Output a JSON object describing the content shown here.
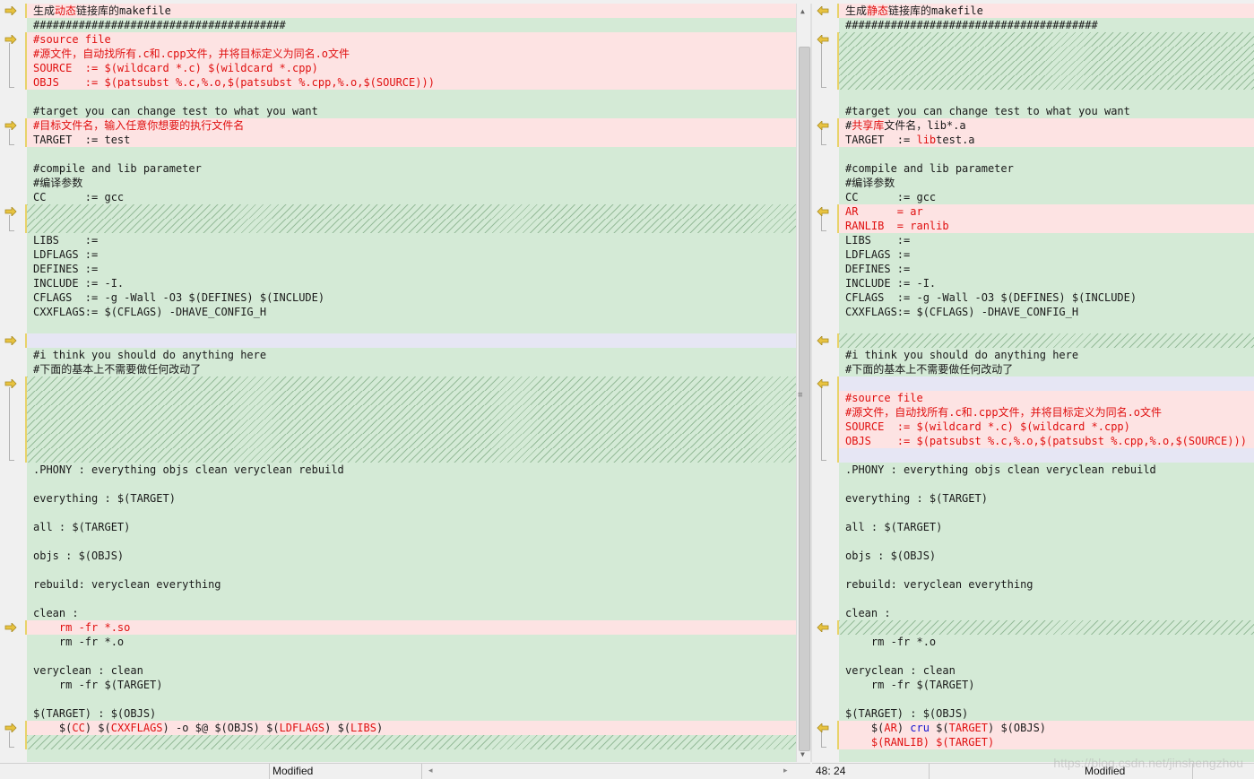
{
  "colors": {
    "equal_bg": "#d4ead6",
    "diff_bg": "#fde3e3",
    "diff_text": "#e01010",
    "arrow": "#e8c340"
  },
  "left": {
    "lines": [
      {
        "t": "diff",
        "p": [
          "生成",
          "动态",
          "链接库的makefile"
        ],
        "r": [
          false,
          true,
          false
        ]
      },
      {
        "t": "eq",
        "p": [
          "#######################################"
        ]
      },
      {
        "t": "diff",
        "p": [
          "#source file"
        ],
        "r": [
          true
        ]
      },
      {
        "t": "diff",
        "p": [
          "#源文件，自动找所有.c和.cpp文件，并将目标定义为同名.o文件"
        ],
        "r": [
          true
        ]
      },
      {
        "t": "diff",
        "p": [
          "SOURCE  := $(wildcard *.c) $(wildcard *.cpp)"
        ],
        "r": [
          true
        ]
      },
      {
        "t": "diff",
        "p": [
          "OBJS    := $(patsubst %.c,%.o,$(patsubst %.cpp,%.o,$(SOURCE)))"
        ],
        "r": [
          true
        ]
      },
      {
        "t": "eq",
        "p": [
          ""
        ]
      },
      {
        "t": "eq",
        "p": [
          "#target you can change test to what you want"
        ]
      },
      {
        "t": "diff",
        "p": [
          "#目标文件名，输入任意你想要的执行文件名"
        ],
        "r": [
          true
        ]
      },
      {
        "t": "diff",
        "p": [
          "TARGET  := test"
        ]
      },
      {
        "t": "eq",
        "p": [
          ""
        ]
      },
      {
        "t": "eq",
        "p": [
          "#compile and lib parameter"
        ]
      },
      {
        "t": "eq",
        "p": [
          "#编译参数"
        ]
      },
      {
        "t": "eq",
        "p": [
          "CC      := gcc"
        ]
      },
      {
        "t": "hatch",
        "p": [
          ""
        ]
      },
      {
        "t": "hatch",
        "p": [
          ""
        ]
      },
      {
        "t": "eq",
        "p": [
          "LIBS    :="
        ]
      },
      {
        "t": "eq",
        "p": [
          "LDFLAGS :="
        ]
      },
      {
        "t": "eq",
        "p": [
          "DEFINES :="
        ]
      },
      {
        "t": "eq",
        "p": [
          "INCLUDE := -I."
        ]
      },
      {
        "t": "eq",
        "p": [
          "CFLAGS  := -g -Wall -O3 $(DEFINES) $(INCLUDE)"
        ]
      },
      {
        "t": "eq",
        "p": [
          "CXXFLAGS:= $(CFLAGS) -DHAVE_CONFIG_H"
        ]
      },
      {
        "t": "eq",
        "p": [
          ""
        ]
      },
      {
        "t": "blank-diff",
        "p": [
          ""
        ]
      },
      {
        "t": "eq",
        "p": [
          "#i think you should do anything here"
        ]
      },
      {
        "t": "eq",
        "p": [
          "#下面的基本上不需要做任何改动了"
        ]
      },
      {
        "t": "hatch",
        "p": [
          ""
        ]
      },
      {
        "t": "hatch",
        "p": [
          ""
        ]
      },
      {
        "t": "hatch",
        "p": [
          ""
        ]
      },
      {
        "t": "hatch",
        "p": [
          ""
        ]
      },
      {
        "t": "hatch",
        "p": [
          ""
        ]
      },
      {
        "t": "hatch",
        "p": [
          ""
        ]
      },
      {
        "t": "eq",
        "p": [
          ".PHONY : everything objs clean veryclean rebuild"
        ]
      },
      {
        "t": "eq",
        "p": [
          ""
        ]
      },
      {
        "t": "eq",
        "p": [
          "everything : $(TARGET)"
        ]
      },
      {
        "t": "eq",
        "p": [
          ""
        ]
      },
      {
        "t": "eq",
        "p": [
          "all : $(TARGET)"
        ]
      },
      {
        "t": "eq",
        "p": [
          ""
        ]
      },
      {
        "t": "eq",
        "p": [
          "objs : $(OBJS)"
        ]
      },
      {
        "t": "eq",
        "p": [
          ""
        ]
      },
      {
        "t": "eq",
        "p": [
          "rebuild: veryclean everything"
        ]
      },
      {
        "t": "eq",
        "p": [
          ""
        ]
      },
      {
        "t": "eq",
        "p": [
          "clean :"
        ]
      },
      {
        "t": "diff",
        "p": [
          "    rm -fr *.so"
        ],
        "r": [
          true
        ]
      },
      {
        "t": "eq",
        "p": [
          "    rm -fr *.o"
        ]
      },
      {
        "t": "eq",
        "p": [
          ""
        ]
      },
      {
        "t": "eq",
        "p": [
          "veryclean : clean"
        ]
      },
      {
        "t": "eq",
        "p": [
          "    rm -fr $(TARGET)"
        ]
      },
      {
        "t": "eq",
        "p": [
          ""
        ]
      },
      {
        "t": "eq",
        "p": [
          "$(TARGET) : $(OBJS)"
        ]
      },
      {
        "t": "diff",
        "p": [
          "    $(",
          "CC",
          ") $(",
          "CXXFLAGS",
          ") -o $@ $(OBJS) $(",
          "LDFLAGS",
          ") $(",
          "LIBS",
          ")"
        ],
        "r": [
          false,
          true,
          false,
          true,
          false,
          true,
          false,
          true,
          false
        ]
      },
      {
        "t": "hatch",
        "p": [
          ""
        ]
      }
    ],
    "status": {
      "mode": "Modified"
    }
  },
  "right": {
    "lines": [
      {
        "t": "diff",
        "p": [
          "生成",
          "静态",
          "链接库的makefile"
        ],
        "r": [
          false,
          true,
          false
        ]
      },
      {
        "t": "eq",
        "p": [
          "#######################################"
        ]
      },
      {
        "t": "hatch",
        "p": [
          ""
        ]
      },
      {
        "t": "hatch",
        "p": [
          ""
        ]
      },
      {
        "t": "hatch",
        "p": [
          ""
        ]
      },
      {
        "t": "hatch",
        "p": [
          ""
        ]
      },
      {
        "t": "eq",
        "p": [
          ""
        ]
      },
      {
        "t": "eq",
        "p": [
          "#target you can change test to what you want"
        ]
      },
      {
        "t": "diff",
        "p": [
          "#",
          "共享库",
          "文件名，lib*.a"
        ],
        "r": [
          false,
          true,
          false
        ]
      },
      {
        "t": "diff",
        "p": [
          "TARGET  := ",
          "lib",
          "test.a"
        ],
        "r": [
          false,
          true,
          false
        ]
      },
      {
        "t": "eq",
        "p": [
          ""
        ]
      },
      {
        "t": "eq",
        "p": [
          "#compile and lib parameter"
        ]
      },
      {
        "t": "eq",
        "p": [
          "#编译参数"
        ]
      },
      {
        "t": "eq",
        "p": [
          "CC      := gcc"
        ]
      },
      {
        "t": "diff",
        "p": [
          "AR      = ar"
        ],
        "r": [
          true
        ]
      },
      {
        "t": "diff",
        "p": [
          "RANLIB  = ranlib"
        ],
        "r": [
          true
        ]
      },
      {
        "t": "eq",
        "p": [
          "LIBS    :="
        ]
      },
      {
        "t": "eq",
        "p": [
          "LDFLAGS :="
        ]
      },
      {
        "t": "eq",
        "p": [
          "DEFINES :="
        ]
      },
      {
        "t": "eq",
        "p": [
          "INCLUDE := -I."
        ]
      },
      {
        "t": "eq",
        "p": [
          "CFLAGS  := -g -Wall -O3 $(DEFINES) $(INCLUDE)"
        ]
      },
      {
        "t": "eq",
        "p": [
          "CXXFLAGS:= $(CFLAGS) -DHAVE_CONFIG_H"
        ]
      },
      {
        "t": "eq",
        "p": [
          ""
        ]
      },
      {
        "t": "hatch",
        "p": [
          ""
        ]
      },
      {
        "t": "eq",
        "p": [
          "#i think you should do anything here"
        ]
      },
      {
        "t": "eq",
        "p": [
          "#下面的基本上不需要做任何改动了"
        ]
      },
      {
        "t": "blank-diff",
        "p": [
          ""
        ]
      },
      {
        "t": "diff",
        "p": [
          "#source file"
        ],
        "r": [
          true
        ]
      },
      {
        "t": "diff",
        "p": [
          "#源文件，自动找所有.c和.cpp文件，并将目标定义为同名.o文件"
        ],
        "r": [
          true
        ]
      },
      {
        "t": "diff",
        "p": [
          "SOURCE  := $(wildcard *.c) $(wildcard *.cpp)"
        ],
        "r": [
          true
        ]
      },
      {
        "t": "diff",
        "p": [
          "OBJS    := $(patsubst %.c,%.o,$(patsubst %.cpp,%.o,$(SOURCE)))"
        ],
        "r": [
          true
        ]
      },
      {
        "t": "blank-diff",
        "p": [
          ""
        ]
      },
      {
        "t": "eq",
        "p": [
          ".PHONY : everything objs clean veryclean rebuild"
        ]
      },
      {
        "t": "eq",
        "p": [
          ""
        ]
      },
      {
        "t": "eq",
        "p": [
          "everything : $(TARGET)"
        ]
      },
      {
        "t": "eq",
        "p": [
          ""
        ]
      },
      {
        "t": "eq",
        "p": [
          "all : $(TARGET)"
        ]
      },
      {
        "t": "eq",
        "p": [
          ""
        ]
      },
      {
        "t": "eq",
        "p": [
          "objs : $(OBJS)"
        ]
      },
      {
        "t": "eq",
        "p": [
          ""
        ]
      },
      {
        "t": "eq",
        "p": [
          "rebuild: veryclean everything"
        ]
      },
      {
        "t": "eq",
        "p": [
          ""
        ]
      },
      {
        "t": "eq",
        "p": [
          "clean :"
        ]
      },
      {
        "t": "hatch",
        "p": [
          ""
        ]
      },
      {
        "t": "eq",
        "p": [
          "    rm -fr *.o"
        ]
      },
      {
        "t": "eq",
        "p": [
          ""
        ]
      },
      {
        "t": "eq",
        "p": [
          "veryclean : clean"
        ]
      },
      {
        "t": "eq",
        "p": [
          "    rm -fr $(TARGET)"
        ]
      },
      {
        "t": "eq",
        "p": [
          ""
        ]
      },
      {
        "t": "eq",
        "p": [
          "$(TARGET) : $(OBJS)"
        ]
      },
      {
        "t": "diff",
        "p": [
          "    $(",
          "AR",
          ") ",
          "cru",
          " $(",
          "TARGET",
          ") $(OBJS)"
        ],
        "r": [
          false,
          true,
          false,
          false,
          false,
          true,
          false
        ],
        "bl": [
          false,
          false,
          false,
          true,
          false,
          false,
          false
        ]
      },
      {
        "t": "diff",
        "p": [
          "    ",
          "$(RANLIB) $(TARGET)"
        ],
        "r": [
          false,
          true
        ]
      }
    ],
    "status": {
      "position": "48: 24",
      "mode": "Modified"
    }
  },
  "left_arrow_rows": [
    0,
    2,
    8,
    14,
    23,
    26,
    43,
    50
  ],
  "right_arrow_rows": [
    0,
    2,
    8,
    14,
    23,
    26,
    43,
    50
  ],
  "watermark": "https://blog.csdn.net/jinshengzhou"
}
